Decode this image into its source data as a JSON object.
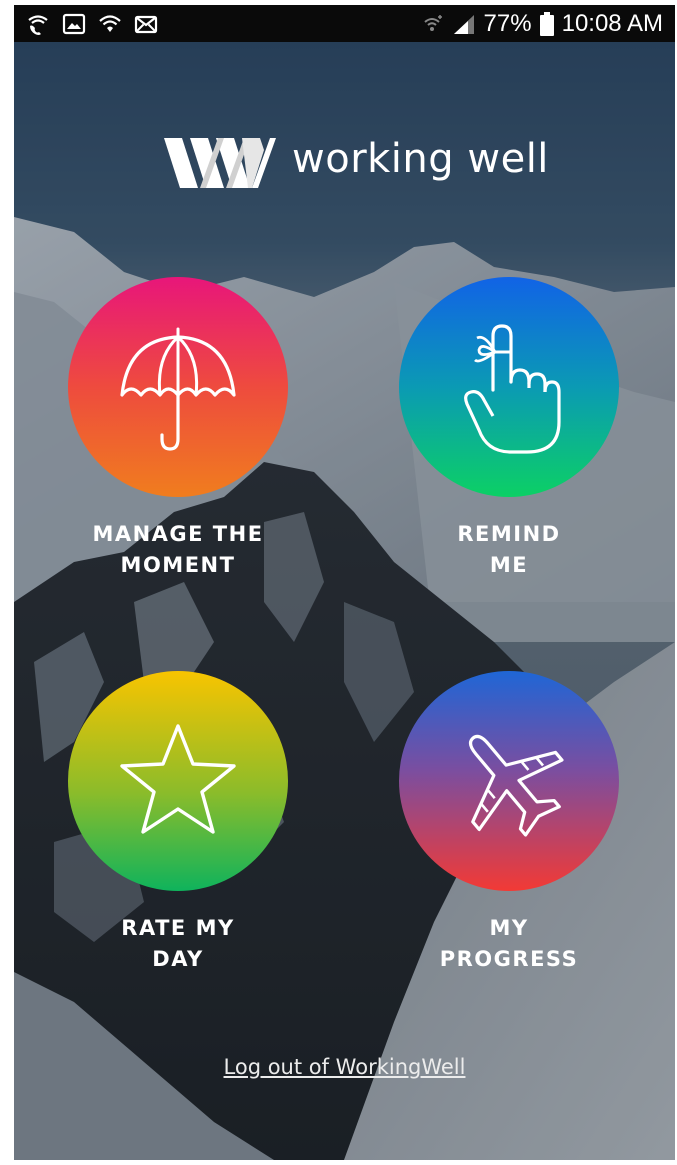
{
  "status_bar": {
    "left_icons": [
      "wifi-calling-icon",
      "gallery-icon",
      "wifi-icon",
      "email-icon"
    ],
    "right_icons": [
      "wifi-signal-icon",
      "cell-signal-icon",
      "battery-icon"
    ],
    "battery": "77%",
    "time": "10:08 AM"
  },
  "app": {
    "logo_text": "working well"
  },
  "tiles": [
    {
      "id": "manage",
      "icon": "umbrella-icon",
      "lines": [
        "MANAGE THE",
        "MOMENT"
      ],
      "colors": [
        "#e8167a",
        "#f07d1e"
      ]
    },
    {
      "id": "remind",
      "icon": "finger-string-icon",
      "lines": [
        "REMIND",
        "ME"
      ],
      "colors": [
        "#1163e6",
        "#0cd065"
      ]
    },
    {
      "id": "rate",
      "icon": "star-icon",
      "lines": [
        "RATE MY",
        "DAY"
      ],
      "colors": [
        "#f8c400",
        "#0fb35c"
      ]
    },
    {
      "id": "progress",
      "icon": "airplane-icon",
      "lines": [
        "MY",
        "PROGRESS"
      ],
      "colors": [
        "#1f66d6",
        "#f23a35"
      ]
    }
  ],
  "logout_link": "Log out of WorkingWell"
}
